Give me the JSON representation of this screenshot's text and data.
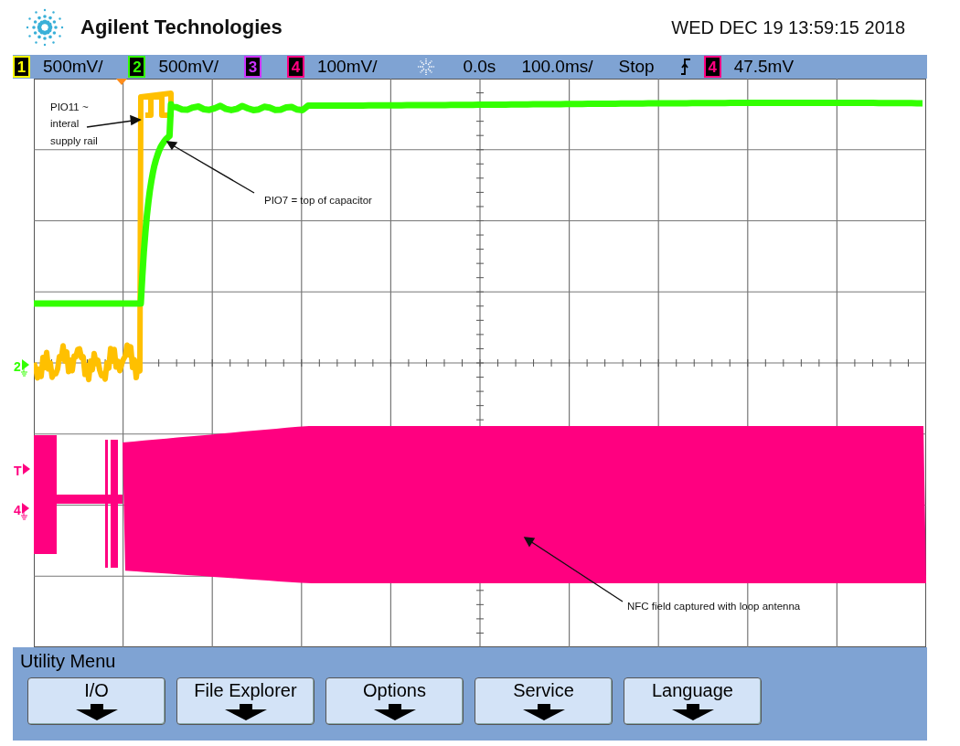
{
  "header": {
    "brand": "Agilent Technologies",
    "datetime": "WED DEC 19 13:59:15 2018"
  },
  "status_bar": {
    "channels": [
      {
        "number": "1",
        "color": "#ffff00",
        "scale": "500mV/"
      },
      {
        "number": "2",
        "color": "#33ff00",
        "scale": "500mV/"
      },
      {
        "number": "3",
        "color": "#cc33ff"
      },
      {
        "number": "4",
        "color": "#ff0080",
        "scale": "100mV/"
      }
    ],
    "delay": "0.0s",
    "timebase": "100.0ms/",
    "run_state": "Stop",
    "trigger": {
      "number": "4",
      "color": "#ff0080",
      "level": "47.5mV"
    }
  },
  "plot": {
    "markers": [
      {
        "label": "2",
        "color": "#33ff00",
        "ground": true
      },
      {
        "label": "T",
        "color": "#ff0080",
        "ground": false
      },
      {
        "label": "4",
        "color": "#ff0080",
        "ground": true
      }
    ],
    "annotations": [
      "PIO11 ~ interal supply rail",
      "PIO7 = top of capacitor",
      "NFC field captured with loop antenna"
    ]
  },
  "menu": {
    "title": "Utility Menu",
    "buttons": [
      "I/O",
      "File Explorer",
      "Options",
      "Service",
      "Language"
    ]
  }
}
